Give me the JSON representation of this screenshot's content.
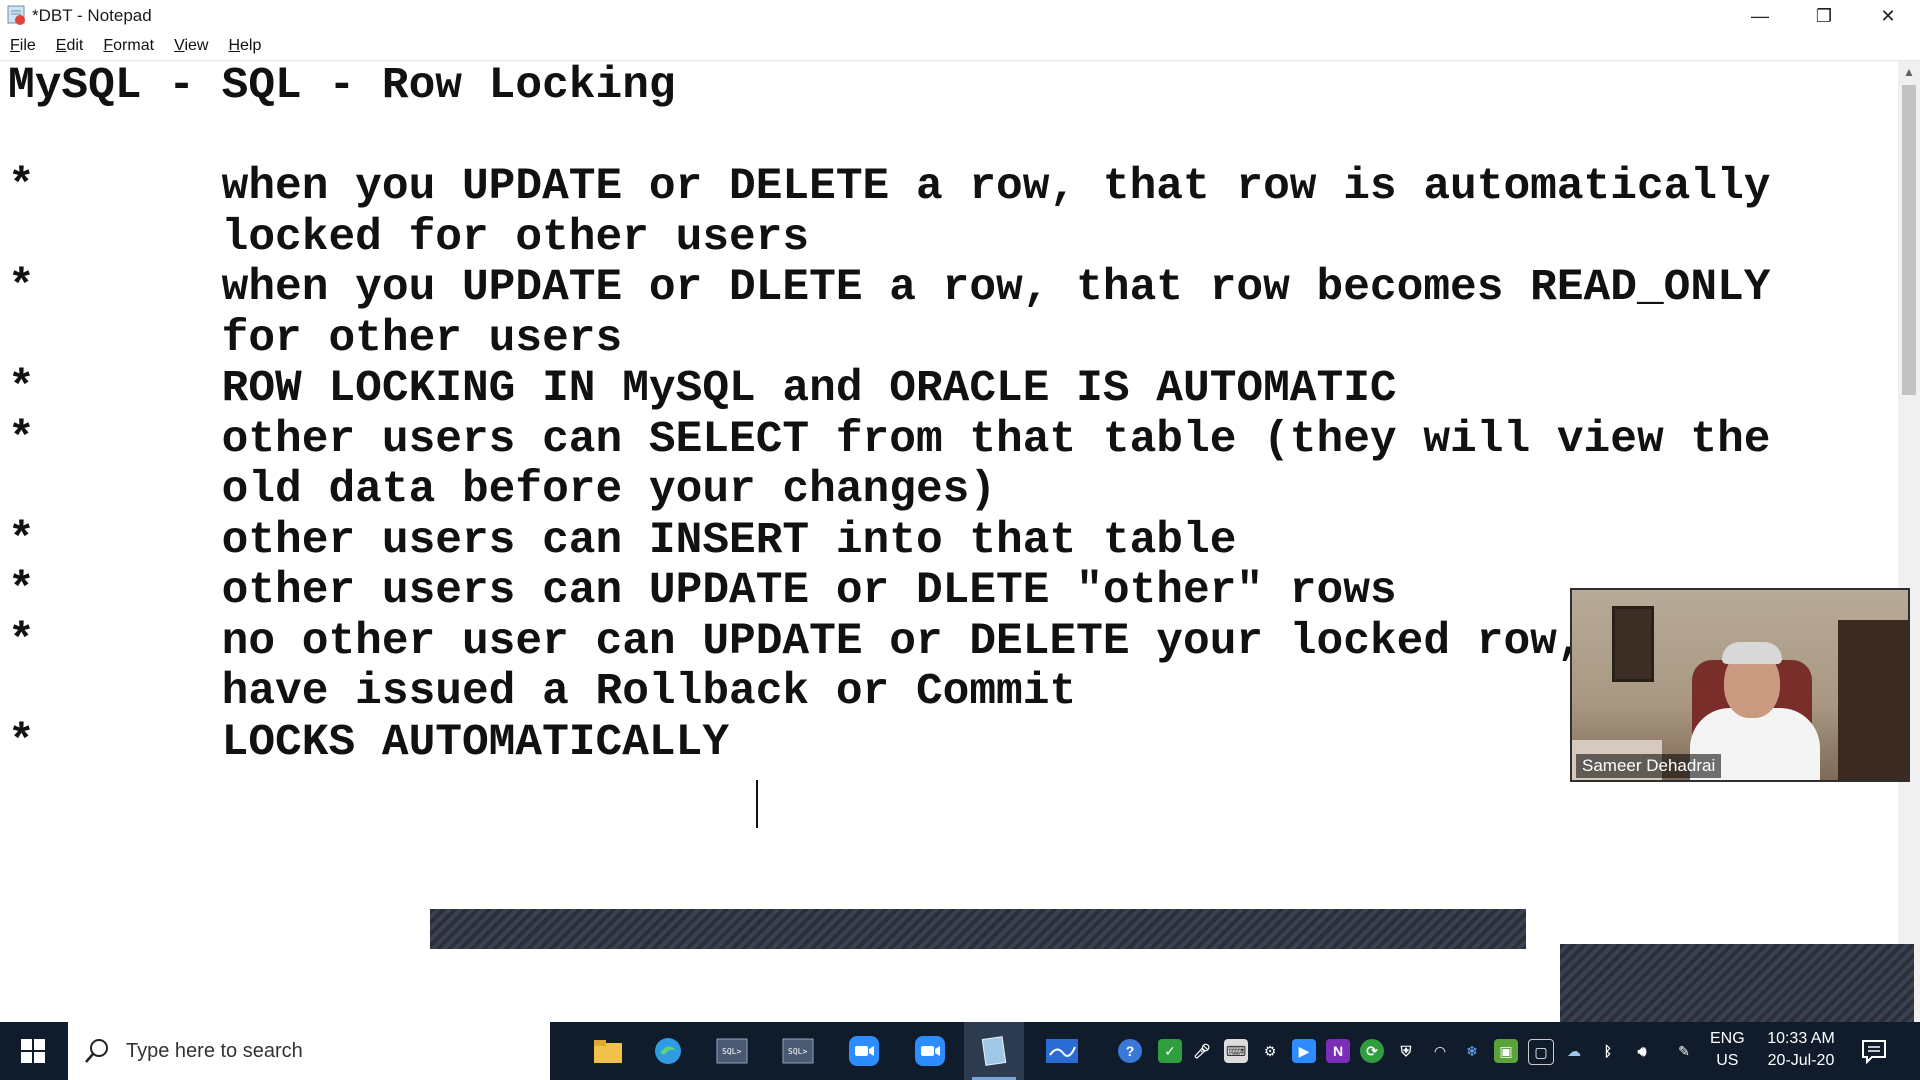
{
  "window": {
    "title": "*DBT - Notepad",
    "minimize_glyph": "—",
    "restore_glyph": "❐",
    "close_glyph": "✕"
  },
  "menu": {
    "items": [
      {
        "label_u": "F",
        "label_rest": "ile"
      },
      {
        "label_u": "E",
        "label_rest": "dit"
      },
      {
        "label_u": "F",
        "label_rest": "ormat"
      },
      {
        "label_u": "V",
        "label_rest": "iew"
      },
      {
        "label_u": "H",
        "label_rest": "elp"
      }
    ]
  },
  "editor": {
    "text": "MySQL - SQL - Row Locking\n\n*       when you UPDATE or DELETE a row, that row is automatically\n        locked for other users\n*       when you UPDATE or DLETE a row, that row becomes READ_ONLY\n        for other users\n*       ROW LOCKING IN MySQL and ORACLE IS AUTOMATIC\n*       other users can SELECT from that table (they will view the\n        old data before your changes)\n*       other users can INSERT into that table\n*       other users can UPDATE or DLETE \"other\" rows\n*       no other user can UPDATE or DELETE your locked row,\n        have issued a Rollback or Commit\n*       LOCKS AUTOMATICALLY "
  },
  "video": {
    "participant_name": "Sameer Dehadrai"
  },
  "taskbar": {
    "search_placeholder": "Type here to search",
    "language_line1": "ENG",
    "language_line2": "US",
    "time": "10:33 AM",
    "date": "20-Jul-20",
    "apps": [
      {
        "icon": "file-explorer-icon",
        "color": "#f0c14b"
      },
      {
        "icon": "edge-icon",
        "color": "#2f9be0"
      },
      {
        "icon": "sql-terminal-icon",
        "color": "#4a5a72"
      },
      {
        "icon": "sql-terminal-icon",
        "color": "#4a5a72"
      },
      {
        "icon": "zoom-icon",
        "color": "#2d8cff"
      },
      {
        "icon": "zoom-icon",
        "color": "#2d8cff"
      },
      {
        "icon": "notepad-icon",
        "color": "#9ec8e6"
      },
      {
        "icon": "whiteboard-icon",
        "color": "#2b6cd4"
      }
    ],
    "accent_color": "#101c2b"
  }
}
